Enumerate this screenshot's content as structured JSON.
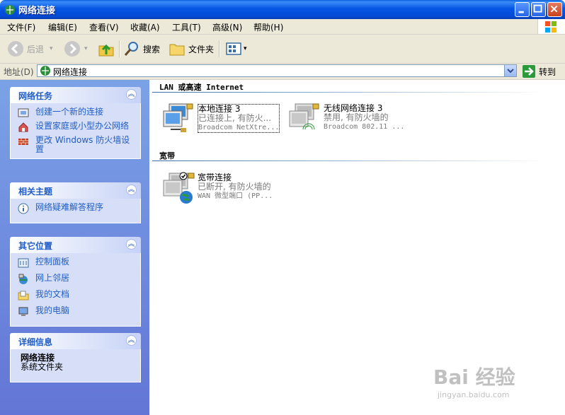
{
  "window": {
    "title": "网络连接"
  },
  "menu": {
    "items": [
      "文件(F)",
      "编辑(E)",
      "查看(V)",
      "收藏(A)",
      "工具(T)",
      "高级(N)",
      "帮助(H)"
    ]
  },
  "toolbar": {
    "back": "后退",
    "search": "搜索",
    "folders": "文件夹"
  },
  "address": {
    "label": "地址(D)",
    "value": "网络连接",
    "go": "转到"
  },
  "sidebar": {
    "network_tasks": {
      "title": "网络任务",
      "items": [
        "创建一个新的连接",
        "设置家庭或小型办公网络",
        "更改 Windows 防火墙设置"
      ]
    },
    "related": {
      "title": "相关主题",
      "items": [
        "网络疑难解答程序"
      ]
    },
    "other_places": {
      "title": "其它位置",
      "items": [
        "控制面板",
        "网上邻居",
        "我的文档",
        "我的电脑"
      ]
    },
    "details": {
      "title": "详细信息",
      "name": "网络连接",
      "type": "系统文件夹"
    }
  },
  "main": {
    "groups": [
      {
        "title": "LAN 或高速 Internet",
        "connections": [
          {
            "name": "本地连接 3",
            "status": "已连接上, 有防火...",
            "device": "Broadcom NetXtre..."
          },
          {
            "name": "无线网络连接 3",
            "status": "禁用, 有防火墙的",
            "device": "Broadcom 802.11 ..."
          }
        ]
      },
      {
        "title": "宽带",
        "connections": [
          {
            "name": "宽带连接",
            "status": "已断开, 有防火墙的",
            "device": "WAN 微型端口 (PP..."
          }
        ]
      }
    ]
  },
  "watermark": {
    "brand": "Bai 经验",
    "url": "jingyan.baidu.com"
  }
}
